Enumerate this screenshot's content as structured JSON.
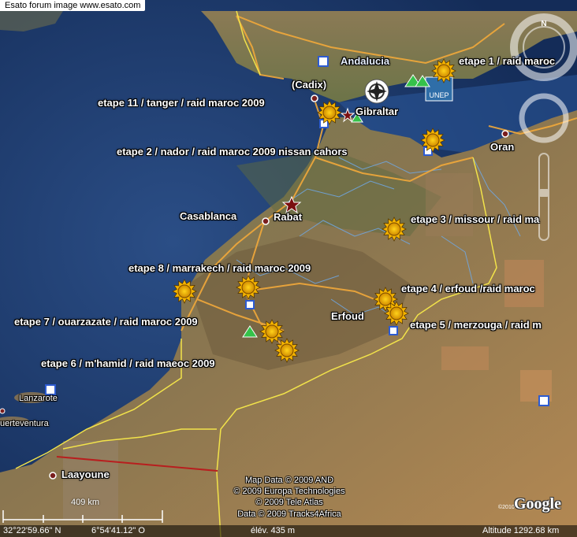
{
  "forum_bar": "Esato forum image www.esato.com",
  "places": {
    "andalucia": "Andalucia",
    "cadix": "(Cadix)",
    "gibraltar": "Gibraltar",
    "oran": "Oran",
    "casablanca": "Casablanca",
    "rabat": "Rabat",
    "erfoud": "Erfoud",
    "lanzarote": "Lanzarote",
    "fuerteventura": "uerteventura",
    "laayoune": "Laayoune"
  },
  "etapes": {
    "e1": "etape 1 / raid maroc",
    "e2": "etape 2 / nador / raid maroc 2009 nissan cahors",
    "e3": "etape 3 / missour / raid ma",
    "e4": "etape 4 / erfoud /raid maroc",
    "e5": "etape 5 / merzouga / raid m",
    "e6": "etape 6 / m'hamid / raid maeoc 2009",
    "e7": "etape 7 / ouarzazate / raid maroc 2009",
    "e8": "etape 8 / marrakech / raid maroc 2009",
    "e11": "etape 11 / tanger / raid maroc 2009"
  },
  "badge": "UNEP",
  "compass_n": "N",
  "copyright": {
    "l1": "Map Data © 2009 AND",
    "l2": "© 2009 Europa Technologies",
    "l3": "© 2009 Tele Atlas",
    "l4": "Data © 2009 Tracks4Africa"
  },
  "google_logo": "Google",
  "google_year": "©2010",
  "scale": "409 km",
  "status": {
    "lat": "32°22'59.66\" N",
    "lon": "6°54'41.12\" O",
    "elev": "élév.   435 m",
    "alt": "Altitude   1292.68 km"
  },
  "colors": {
    "sea": "#1d3a6b",
    "land": "#7a6a4a",
    "desert": "#b08650",
    "border": "#f2e34a",
    "road": "#f2a93a",
    "river": "#6fa9e8",
    "red_line": "#b81e1e"
  }
}
